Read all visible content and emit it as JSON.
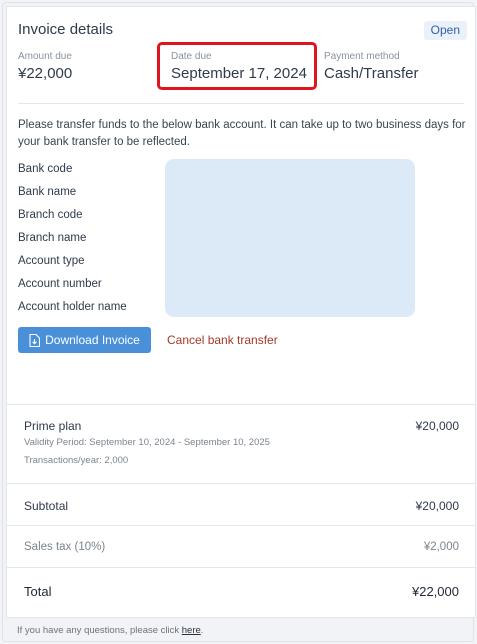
{
  "invoice": {
    "title": "Invoice details",
    "status": "Open",
    "amount_due_label": "Amount due",
    "amount_due": "¥22,000",
    "date_due_label": "Date due",
    "date_due": "September 17, 2024",
    "payment_method_label": "Payment method",
    "payment_method": "Cash/Transfer"
  },
  "transfer": {
    "intro": "Please transfer funds to the below bank account. It can take up to two business days for your bank transfer to be reflected.",
    "labels": [
      "Bank code",
      "Bank name",
      "Branch code",
      "Branch name",
      "Account type",
      "Account number",
      "Account holder name"
    ],
    "download_label": "Download Invoice",
    "cancel_label": "Cancel bank transfer"
  },
  "summary": {
    "plan_name": "Prime plan",
    "plan_amount": "¥20,000",
    "validity": "Validity Period: September 10, 2024 - September 10, 2025",
    "transactions": "Transactions/year: 2,000",
    "subtotal_label": "Subtotal",
    "subtotal": "¥20,000",
    "tax_label": "Sales tax (10%)",
    "tax": "¥2,000",
    "total_label": "Total",
    "total": "¥22,000"
  },
  "footer": {
    "text": "If you have any questions, please click ",
    "link": "here",
    "suffix": "."
  },
  "icons": {
    "download": "document-download-icon"
  },
  "colors": {
    "accent": "#4a90d9",
    "danger_link": "#a23a2a",
    "highlight": "#e0141e"
  }
}
